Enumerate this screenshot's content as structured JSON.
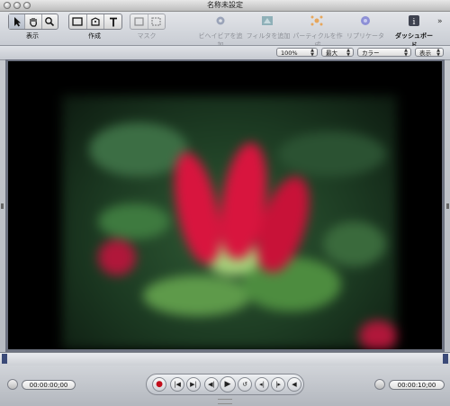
{
  "window": {
    "title": "名称未設定"
  },
  "toolbar": {
    "groups": [
      {
        "label": "表示"
      },
      {
        "label": "作成"
      },
      {
        "label": "マスク"
      }
    ],
    "actions": [
      {
        "label": "ビヘイビアを追加"
      },
      {
        "label": "フィルタを追加"
      },
      {
        "label": "パーティクルを作成"
      },
      {
        "label": "リプリケータ"
      },
      {
        "label": "ダッシュボード"
      }
    ],
    "overflow": "»"
  },
  "options": {
    "zoom": "100%",
    "resolution": "最大",
    "channels": "カラー",
    "view": "表示"
  },
  "transport": {
    "current_time": "00:00:00;00",
    "duration": "00:00:10;00"
  },
  "colors": {
    "canvas_bg": "#000000",
    "record": "#c20e1b",
    "timeline_marker": "#3b4a78"
  }
}
